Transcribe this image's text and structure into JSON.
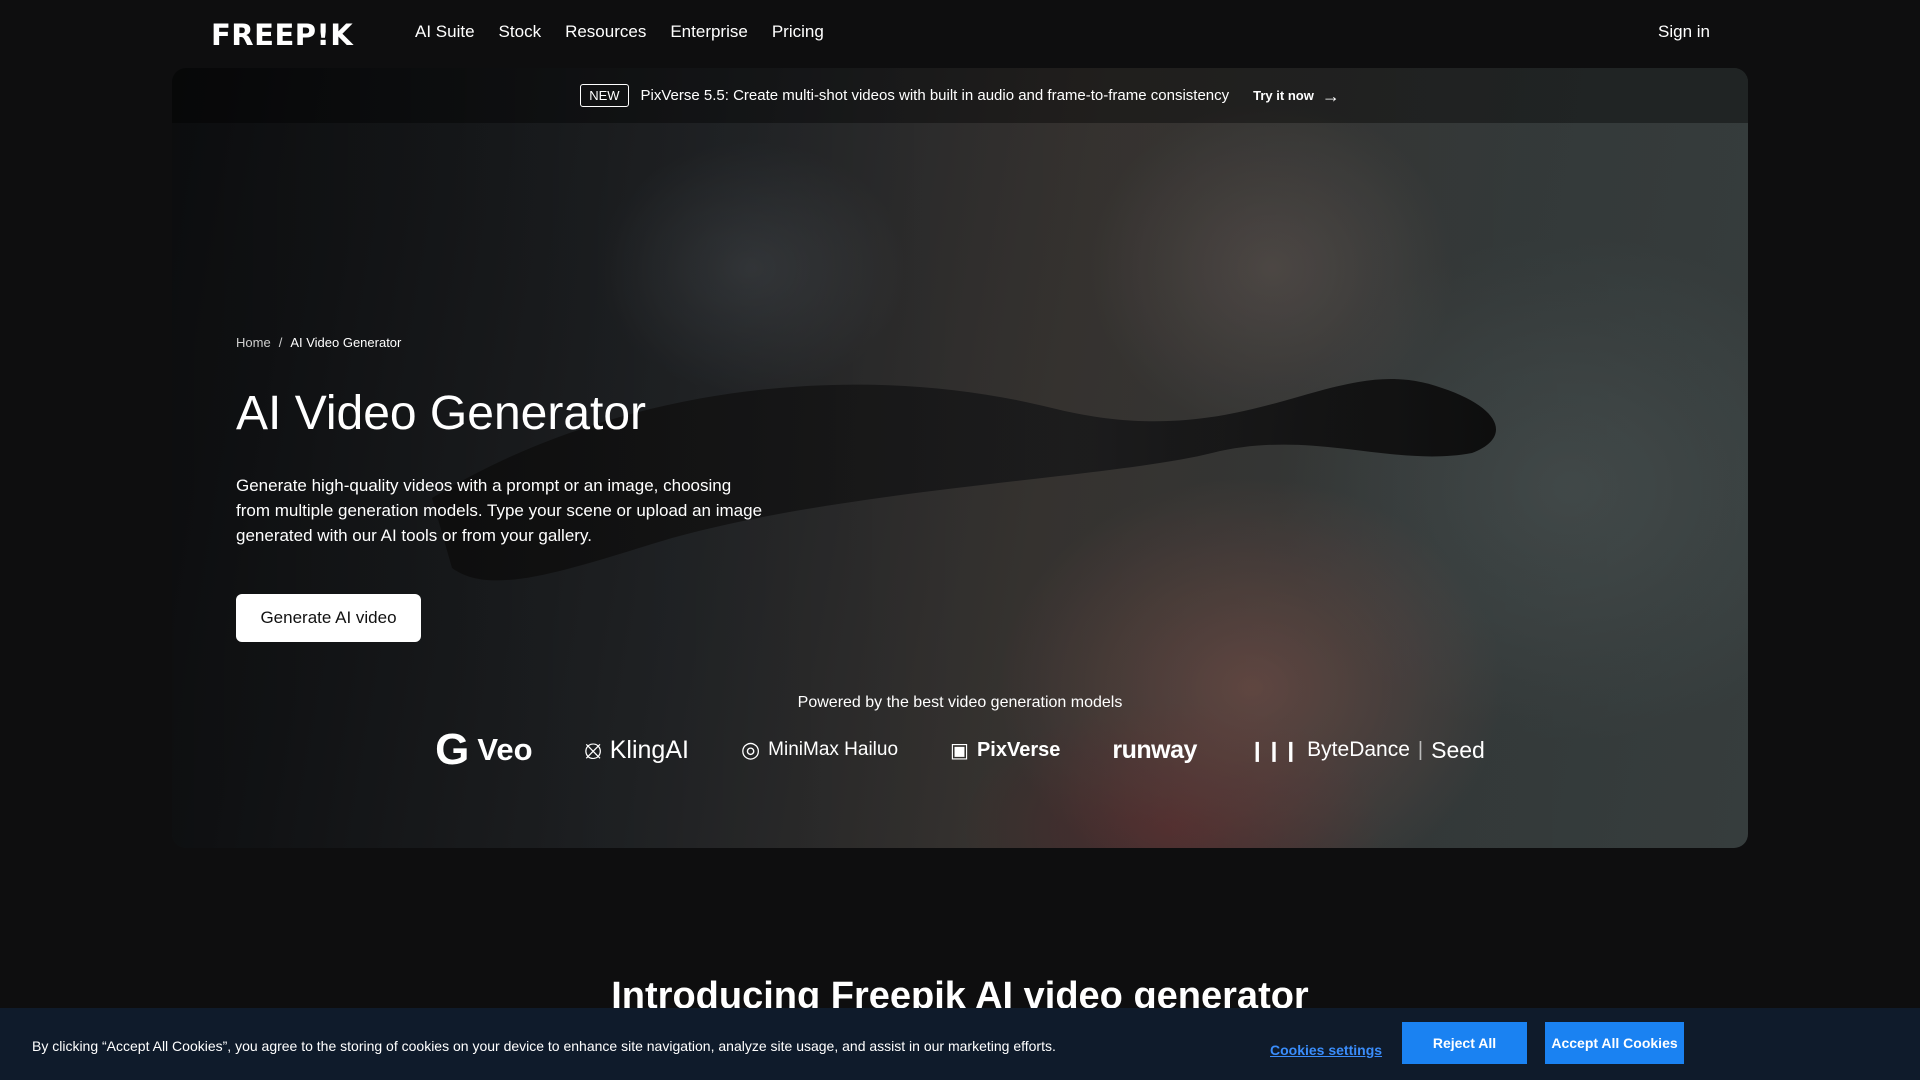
{
  "nav": {
    "logo": "FREEP!K",
    "links": [
      "AI Suite",
      "Stock",
      "Resources",
      "Enterprise",
      "Pricing"
    ],
    "signin": "Sign in"
  },
  "announcement": {
    "badge": "NEW",
    "text": "PixVerse 5.5: Create multi-shot videos with built in audio and frame-to-frame consistency",
    "cta": "Try it now",
    "cta_icon": "arrow-right-icon"
  },
  "breadcrumb": {
    "home": "Home",
    "separator": "/",
    "current": "AI Video Generator"
  },
  "hero": {
    "title": "AI Video Generator",
    "description": "Generate high-quality videos with a prompt or an image, choosing from multiple generation models. Type your scene or upload an image generated with our AI tools or from your gallery.",
    "cta": "Generate AI video",
    "powered_by": "Powered by the best video generation models"
  },
  "models": {
    "veo_icon": "G",
    "veo": "Veo",
    "kling_icon": "⦻",
    "kling": "KlingAI",
    "minimax_icon": "◎",
    "minimax": "MiniMax Hailuo",
    "pixverse_icon": "▣",
    "pixverse": "PixVerse",
    "runway": "runway",
    "bytedance_icon": "❙❙❙",
    "bytedance": "ByteDance",
    "bytedance_sep": "|",
    "seed": "Seed"
  },
  "section": {
    "title": "Introducing Freepik AI video generator"
  },
  "cookies": {
    "text": "By clicking “Accept All Cookies”, you agree to the storing of cookies on your device to enhance site navigation, analyze site usage, and assist in our marketing efforts.",
    "settings": "Cookies settings",
    "reject": "Reject All",
    "accept": "Accept All Cookies"
  },
  "colors": {
    "background": "#0e0e0f",
    "cookie_bar": "#0f1b2b",
    "cookie_button": "#1a82f2",
    "cookie_link": "#3a8dfb"
  }
}
